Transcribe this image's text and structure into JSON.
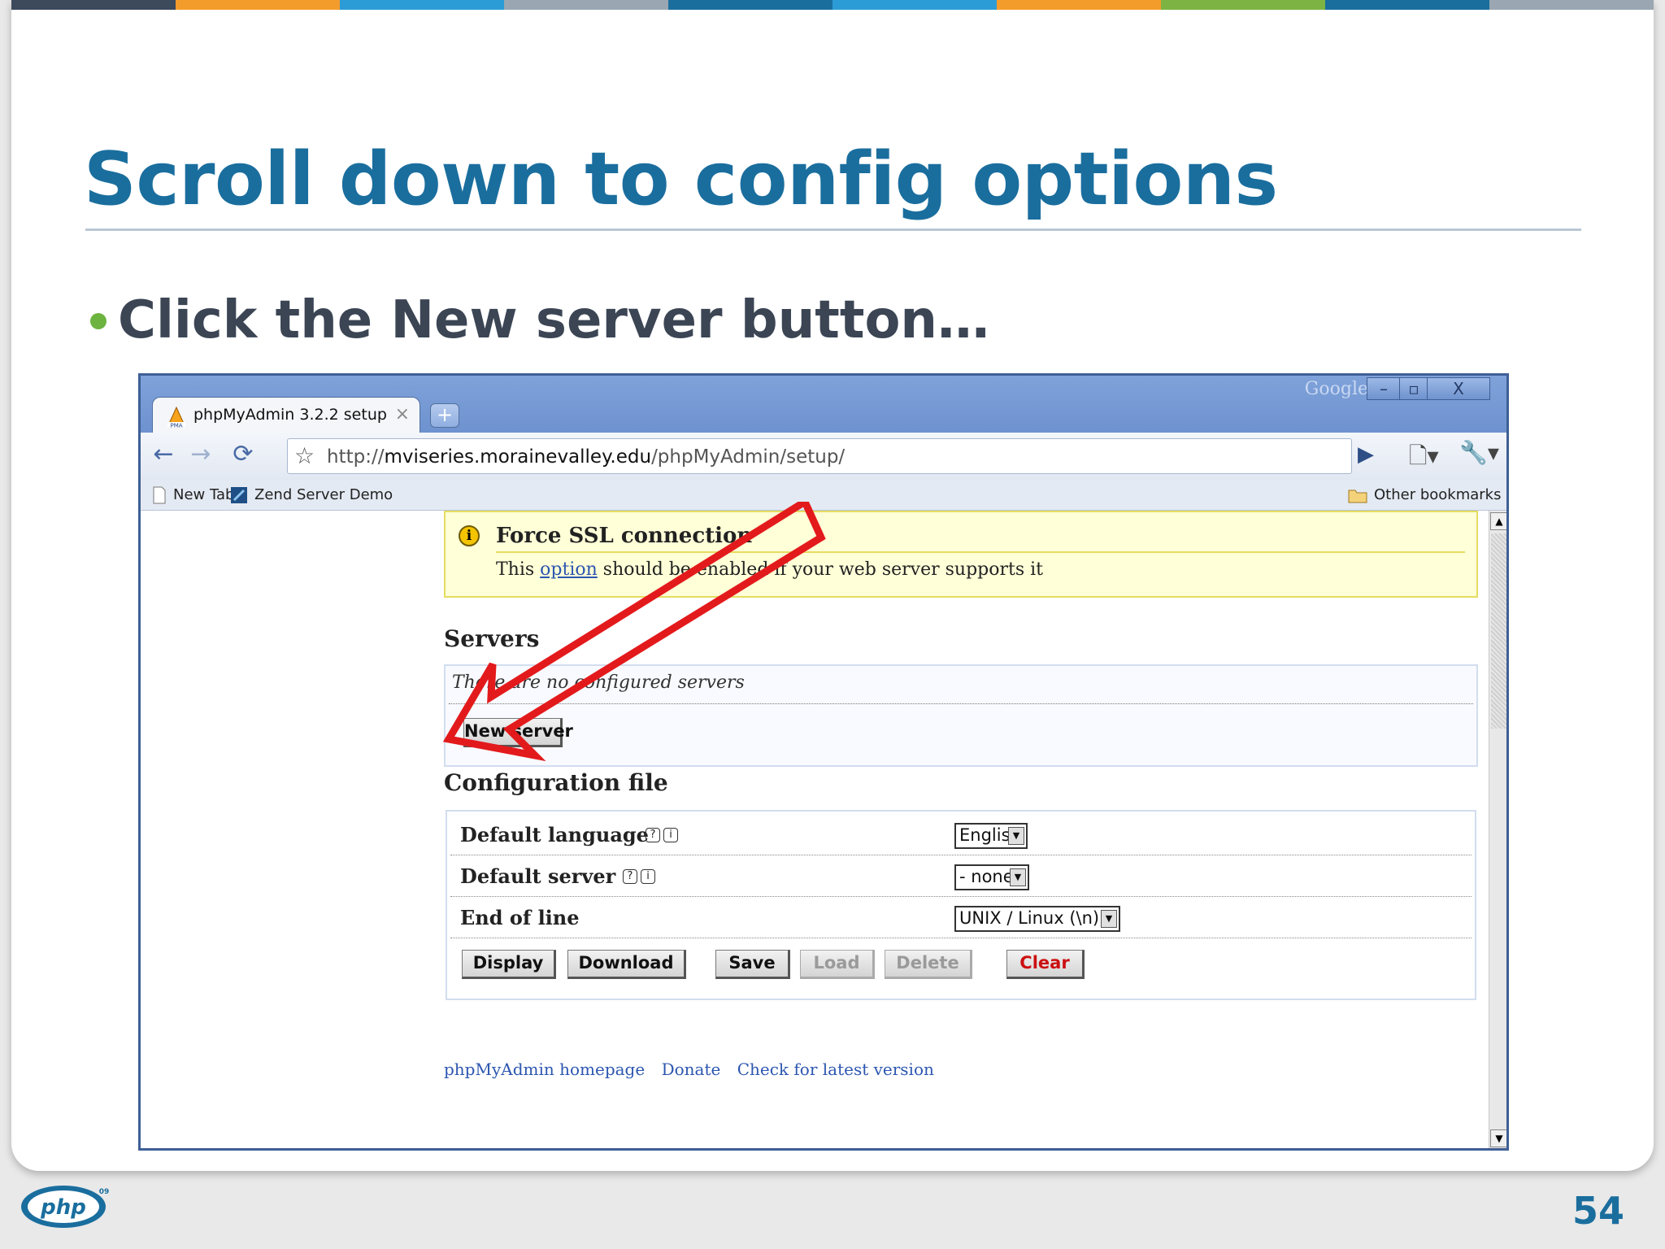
{
  "slide": {
    "title": "Scroll down to config options",
    "bullet": "Click the New server button…",
    "page_number": "54",
    "stripe_colors": [
      "#3c4a5c",
      "#f39c2c",
      "#2c9cd6",
      "#9aa7b2",
      "#1a6e9e",
      "#2c9cd6",
      "#f39c2c",
      "#7cb342",
      "#1a6e9e",
      "#9aa7b2"
    ],
    "title_color": "#1a6e9e",
    "bullet_color": "#6db33f"
  },
  "browser": {
    "google_label": "Google",
    "window_buttons": {
      "minimize": "–",
      "maximize": "▫",
      "close": "X"
    },
    "tab": {
      "title": "phpMyAdmin 3.2.2 setup",
      "close": "×",
      "new_tab": "+"
    },
    "url_prefix": "http://",
    "url_host": "mviseries.morainevalley.edu",
    "url_path": "/phpMyAdmin/setup/",
    "bookmarks": [
      {
        "label": "New Tab",
        "icon": "page-icon"
      },
      {
        "label": "Zend Server Demo",
        "icon": "zend-icon"
      }
    ],
    "other_bookmarks": "Other bookmarks"
  },
  "page": {
    "ssl_notice": {
      "icon": "info-icon",
      "title": "Force SSL connection",
      "text_before": "This",
      "link": "option",
      "text_after": "should be enabled if your web server supports it"
    },
    "servers": {
      "heading": "Servers",
      "empty_message": "There are no configured servers",
      "new_server_button": "New server"
    },
    "config_file": {
      "heading": "Configuration file",
      "rows": [
        {
          "label": "Default language",
          "value": "English"
        },
        {
          "label": "Default server",
          "value": "- none -"
        },
        {
          "label": "End of line",
          "value": "UNIX / Linux (\\n)"
        }
      ],
      "buttons": {
        "display": "Display",
        "download": "Download",
        "save": "Save",
        "load": "Load",
        "delete": "Delete",
        "clear": "Clear"
      }
    },
    "footer_links": [
      "phpMyAdmin homepage",
      "Donate",
      "Check for latest version"
    ]
  },
  "colors": {
    "browser_frame": "#6e93cf",
    "link": "#2c56b0",
    "notice_bg": "#ffffd8",
    "notice_border": "#e6dc60",
    "annotation_arrow": "#e31a1c",
    "clear_button_text": "#cc1010"
  }
}
